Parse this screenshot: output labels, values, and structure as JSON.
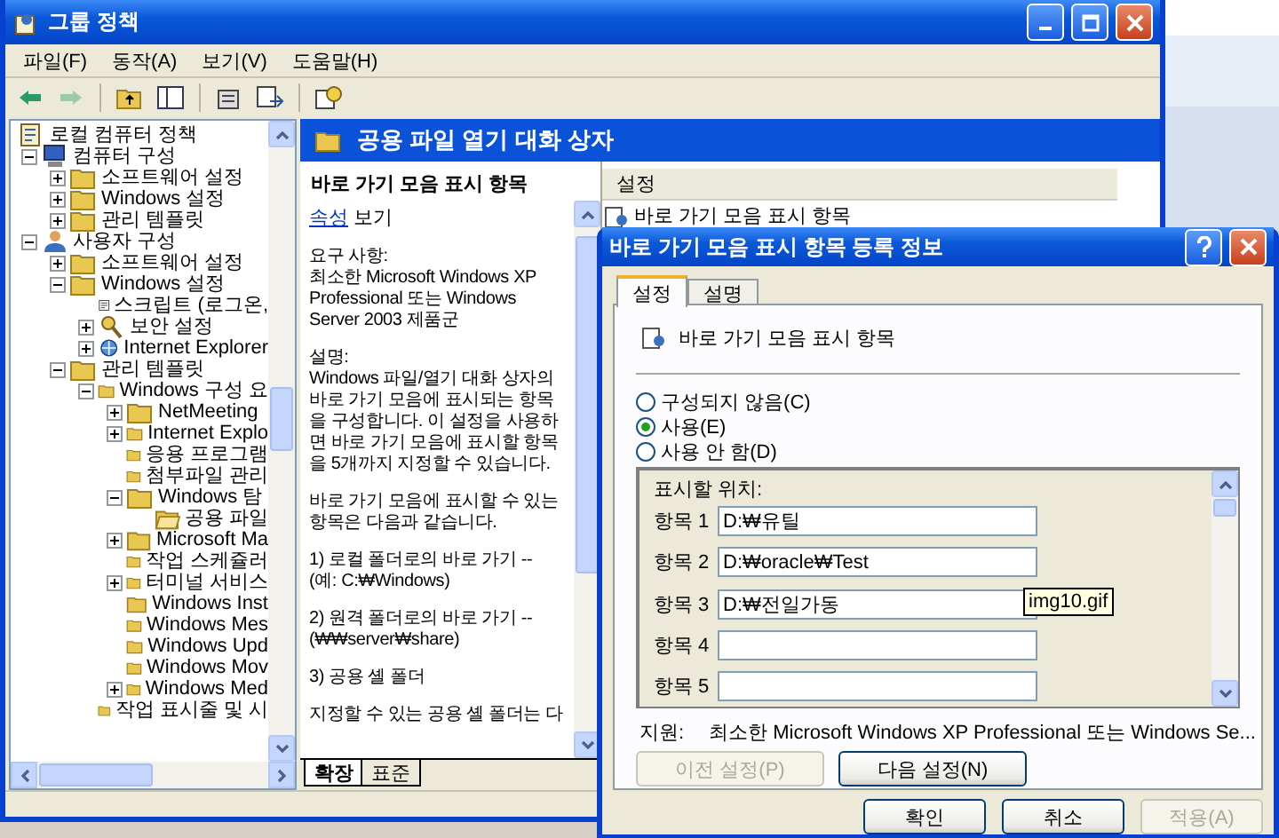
{
  "window": {
    "title": "그룹 정책"
  },
  "menu": [
    "파일(F)",
    "동작(A)",
    "보기(V)",
    "도움말(H)"
  ],
  "toolbar": [
    {
      "kind": "back",
      "disabled": false
    },
    {
      "kind": "forward",
      "disabled": true
    },
    {
      "kind": "up",
      "disabled": false
    },
    {
      "kind": "tree",
      "disabled": false
    },
    {
      "kind": "properties",
      "disabled": false
    },
    {
      "kind": "export",
      "disabled": false
    },
    {
      "kind": "help",
      "disabled": false
    }
  ],
  "tree": [
    {
      "label": "로컬 컴퓨터 정책",
      "kind": "policy",
      "children": [
        {
          "label": "컴퓨터 구성",
          "kind": "computer",
          "expanded": true,
          "children": [
            {
              "label": "소프트웨어 설정",
              "kind": "folder",
              "expanded": false
            },
            {
              "label": "Windows 설정",
              "kind": "folder",
              "expanded": false
            },
            {
              "label": "관리 템플릿",
              "kind": "folder",
              "expanded": false
            }
          ]
        },
        {
          "label": "사용자 구성",
          "kind": "user",
          "expanded": true,
          "children": [
            {
              "label": "소프트웨어 설정",
              "kind": "folder",
              "expanded": false
            },
            {
              "label": "Windows 설정",
              "kind": "folder",
              "expanded": true,
              "children": [
                {
                  "label": "스크립트 (로그온,",
                  "kind": "script"
                },
                {
                  "label": "보안 설정",
                  "kind": "security",
                  "expanded": false
                },
                {
                  "label": "Internet Explorer",
                  "kind": "browser",
                  "expanded": false
                }
              ]
            },
            {
              "label": "관리 템플릿",
              "kind": "folder",
              "expanded": true,
              "children": [
                {
                  "label": "Windows 구성 요",
                  "kind": "folder",
                  "expanded": true,
                  "children": [
                    {
                      "label": "NetMeeting",
                      "kind": "folder",
                      "expanded": false
                    },
                    {
                      "label": "Internet Explo",
                      "kind": "folder",
                      "expanded": false
                    },
                    {
                      "label": "응용 프로그램",
                      "kind": "folder"
                    },
                    {
                      "label": "첨부파일 관리",
                      "kind": "folder"
                    },
                    {
                      "label": "Windows 탐",
                      "kind": "folder",
                      "expanded": true,
                      "children": [
                        {
                          "label": "공용 파일",
                          "kind": "open-folder"
                        }
                      ]
                    },
                    {
                      "label": "Microsoft Ma",
                      "kind": "folder",
                      "expanded": false
                    },
                    {
                      "label": "작업 스케쥴러",
                      "kind": "folder"
                    },
                    {
                      "label": "터미널 서비스",
                      "kind": "folder",
                      "expanded": false
                    },
                    {
                      "label": "Windows Inst",
                      "kind": "folder"
                    },
                    {
                      "label": "Windows Mes",
                      "kind": "folder"
                    },
                    {
                      "label": "Windows Upd",
                      "kind": "folder"
                    },
                    {
                      "label": "Windows Mov",
                      "kind": "folder"
                    },
                    {
                      "label": "Windows Med",
                      "kind": "folder",
                      "expanded": false
                    }
                  ]
                },
                {
                  "label": "작업 표시줄 및 시",
                  "kind": "folder"
                }
              ]
            }
          ]
        }
      ]
    }
  ],
  "header": "공용 파일 열기 대화 상자",
  "description": {
    "title": "바로 가기 모음 표시 항목",
    "link": "속성",
    "link_suffix": "보기",
    "paragraphs": [
      "요구 사항:\n최소한 Microsoft Windows XP Professional 또는 Windows Server 2003 제품군",
      "설명:\nWindows 파일/열기 대화 상자의 바로 가기 모음에 표시되는 항목을 구성합니다. 이 설정을 사용하면 바로 가기 모음에 표시할 항목을 5개까지 지정할 수 있습니다.",
      "바로 가기 모음에 표시할 수 있는 항목은 다음과 같습니다.",
      "1) 로컬 폴더로의 바로 가기 --\n(예: C:₩Windows)",
      "2) 원격 폴더로의 바로 가기 --\n(₩₩server₩share)",
      "3) 공용 셸 폴더",
      "지정할 수 있는 공용 셸 폴더는 다"
    ]
  },
  "view_tabs": [
    {
      "label": "확장",
      "selected": true
    },
    {
      "label": "표준",
      "selected": false
    }
  ],
  "settings_list": {
    "column": "설정",
    "items": [
      "바로 가기 모음 표시 항목"
    ]
  },
  "dialog": {
    "title": "바로 가기 모음 표시 항목 등록 정보",
    "tabs": [
      {
        "label": "설정",
        "selected": true
      },
      {
        "label": "설명",
        "selected": false
      }
    ],
    "policy": "바로 가기 모음 표시 항목",
    "options": [
      {
        "label": "구성되지 않음(C)",
        "selected": false
      },
      {
        "label": "사용(E)",
        "selected": true
      },
      {
        "label": "사용 안 함(D)",
        "selected": false
      }
    ],
    "places_label": "표시할 위치:",
    "places": [
      {
        "label": "항목 1",
        "value": "D:₩유틸"
      },
      {
        "label": "항목 2",
        "value": "D:₩oracle₩Test"
      },
      {
        "label": "항목 3",
        "value": "D:₩전일가동"
      },
      {
        "label": "항목 4"
      },
      {
        "label": "항목 5"
      }
    ],
    "tooltip": "img10.gif",
    "support_label": "지원:",
    "support": "최소한 Microsoft Windows XP Professional 또는 Windows Se...",
    "nav_buttons": [
      {
        "label": "이전 설정(P)",
        "disabled": true
      },
      {
        "label": "다음 설정(N)",
        "disabled": false
      }
    ],
    "buttons": [
      {
        "label": "확인",
        "disabled": false
      },
      {
        "label": "취소",
        "disabled": false
      },
      {
        "label": "적용(A)",
        "disabled": true
      }
    ]
  }
}
